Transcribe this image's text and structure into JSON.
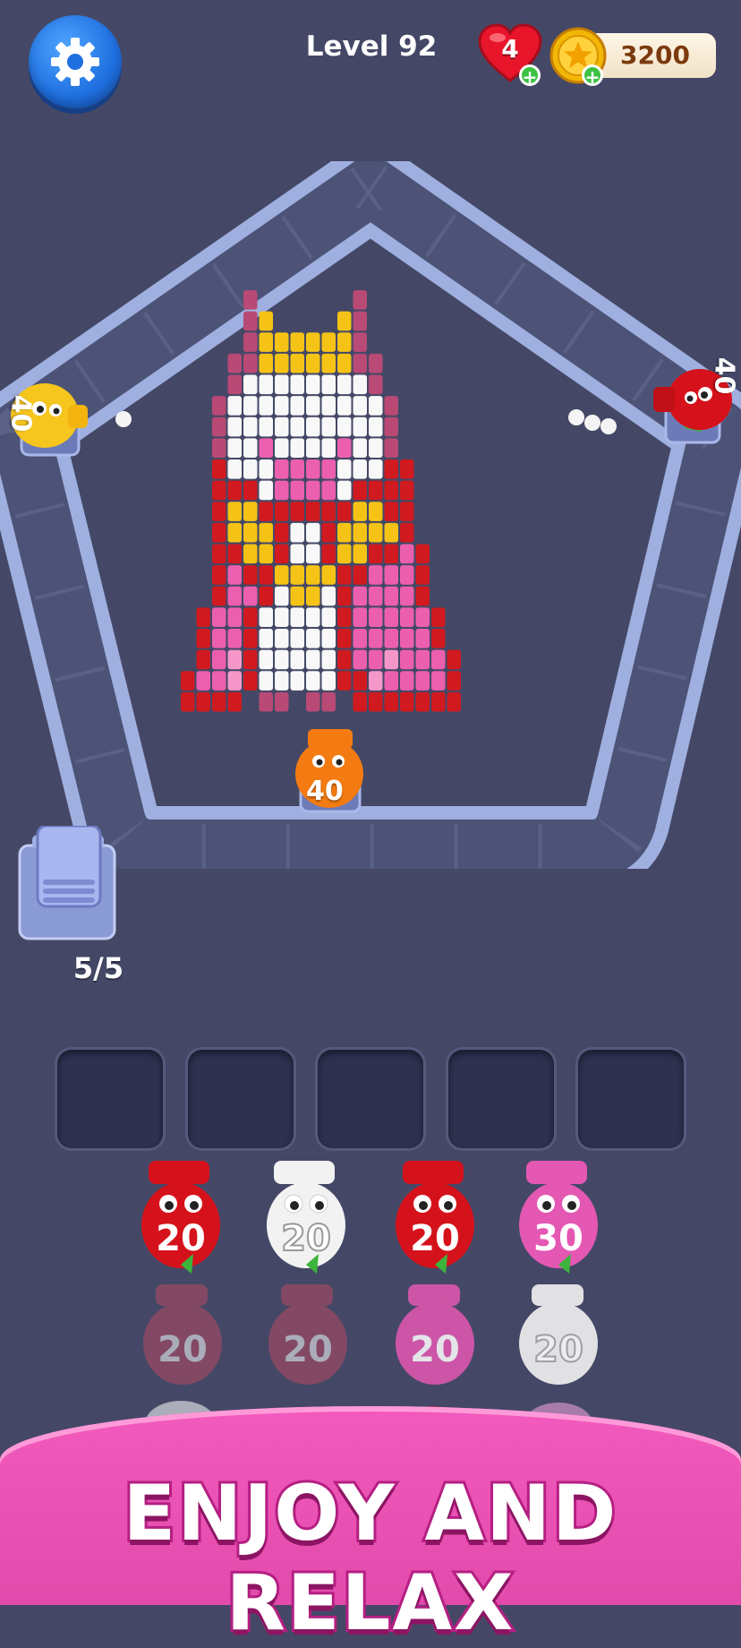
{
  "header": {
    "level": "Level 92",
    "lives": "4",
    "coins": "3200"
  },
  "stack": {
    "counter": "5/5"
  },
  "board": {
    "shooters": [
      {
        "name": "yellow",
        "ammo": "40",
        "color": "#f6c51e"
      },
      {
        "name": "red",
        "ammo": "40",
        "color": "#d5121b"
      },
      {
        "name": "orange",
        "ammo": "40",
        "color": "#f47b12"
      }
    ],
    "pixel_art_palette": {
      "R": "#d11a1f",
      "P": "#ec5fae",
      "W": "#f8f8f8",
      "Y": "#f4c316",
      "M": "#b84a75",
      "L": "#f597c8"
    }
  },
  "queue": {
    "rows": [
      [
        {
          "value": "20",
          "color": "#d5121b"
        },
        {
          "value": "20",
          "color": "#f2f2f2"
        },
        {
          "value": "20",
          "color": "#d5121b"
        },
        {
          "value": "30",
          "color": "#e458b3"
        }
      ],
      [
        {
          "value": "20",
          "color": "#b74a63"
        },
        {
          "value": "20",
          "color": "#b74a63"
        },
        {
          "value": "20",
          "color": "#e458b3"
        },
        {
          "value": "20",
          "color": "#f2f2f2"
        }
      ]
    ]
  },
  "banner": {
    "text": "ENJOY AND RELAX"
  }
}
